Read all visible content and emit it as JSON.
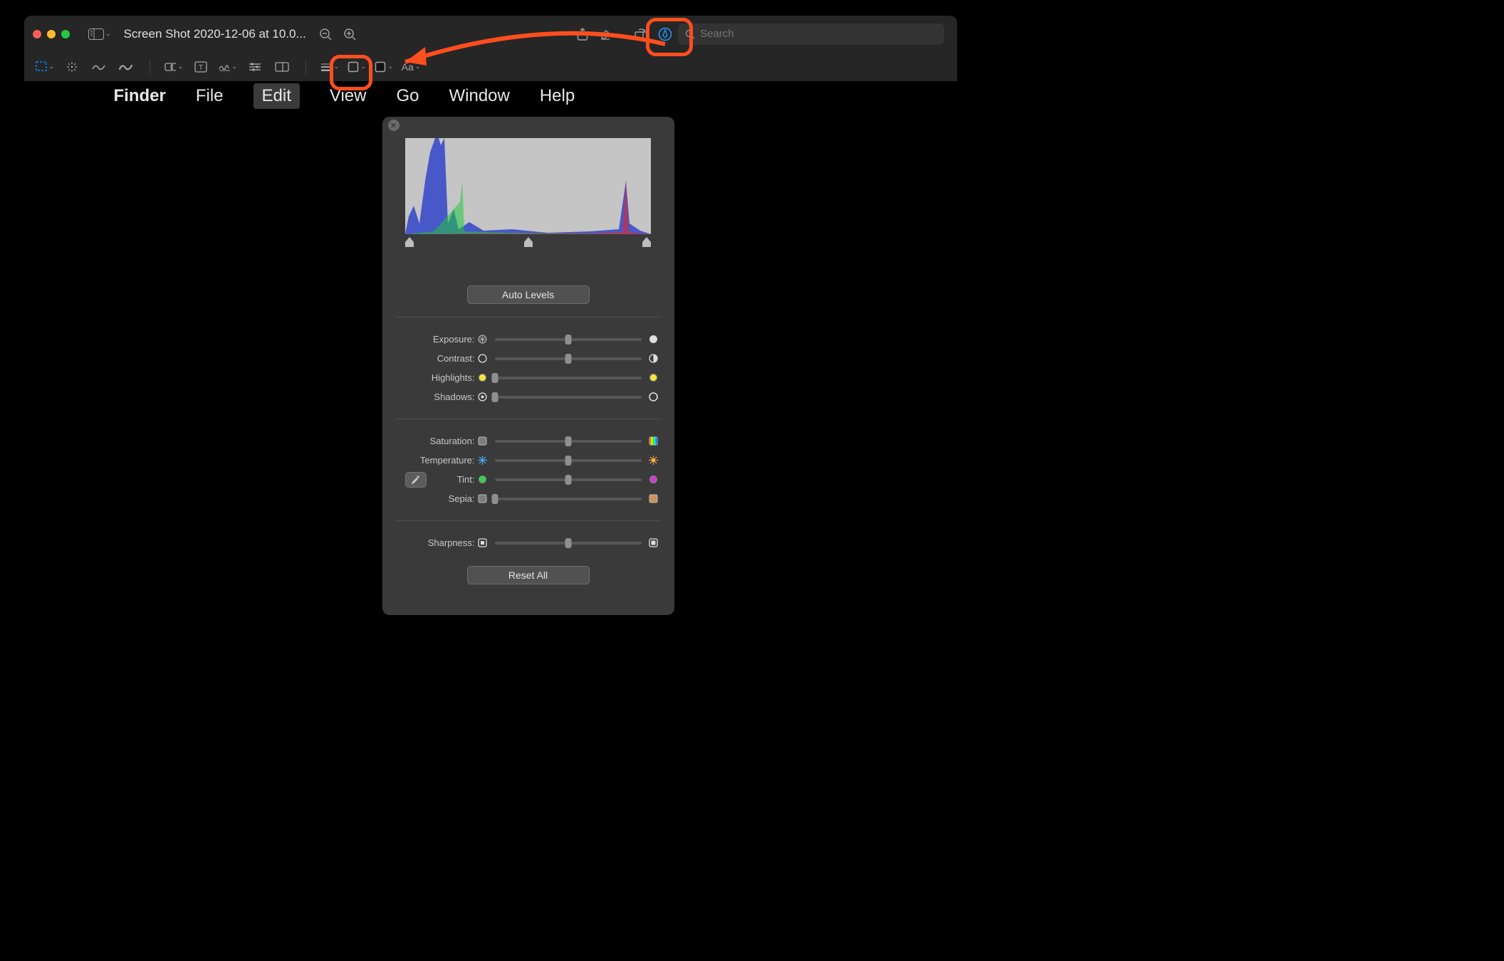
{
  "window": {
    "title": "Screen Shot 2020-12-06 at 10.0..."
  },
  "search": {
    "placeholder": "Search"
  },
  "font_control": {
    "label": "Aa"
  },
  "menubar": {
    "app": "Finder",
    "items": [
      "File",
      "Edit",
      "View",
      "Go",
      "Window",
      "Help"
    ],
    "active_index": 1
  },
  "popover": {
    "auto_levels_label": "Auto Levels",
    "reset_all_label": "Reset All",
    "sliders": {
      "exposure": {
        "label": "Exposure:",
        "pos": 50,
        "left_icon": "aperture-icon",
        "right_icon": "aperture-filled-icon"
      },
      "contrast": {
        "label": "Contrast:",
        "pos": 50,
        "left_icon": "circle-outline-icon",
        "right_icon": "half-circle-icon"
      },
      "highlights": {
        "label": "Highlights:",
        "pos": 0,
        "left_icon": "sun-yellow-icon",
        "right_icon": "sun-yellow-icon"
      },
      "shadows": {
        "label": "Shadows:",
        "pos": 0,
        "left_icon": "dot-circle-icon",
        "right_icon": "ring-icon"
      },
      "saturation": {
        "label": "Saturation:",
        "pos": 50,
        "left_icon": "square-gray-icon",
        "right_icon": "rainbow-icon"
      },
      "temperature": {
        "label": "Temperature:",
        "pos": 50,
        "left_icon": "snowflake-blue-icon",
        "right_icon": "sun-orange-icon"
      },
      "tint": {
        "label": "Tint:",
        "pos": 50,
        "left_icon": "circle-green-icon",
        "right_icon": "circle-magenta-icon"
      },
      "sepia": {
        "label": "Sepia:",
        "pos": 0,
        "left_icon": "square-gray-icon",
        "right_icon": "square-sepia-icon"
      },
      "sharpness": {
        "label": "Sharpness:",
        "pos": 50,
        "left_icon": "square-blur-icon",
        "right_icon": "square-sharp-icon"
      }
    }
  },
  "annotations": {
    "highlight_color": "#FF4E1E"
  }
}
